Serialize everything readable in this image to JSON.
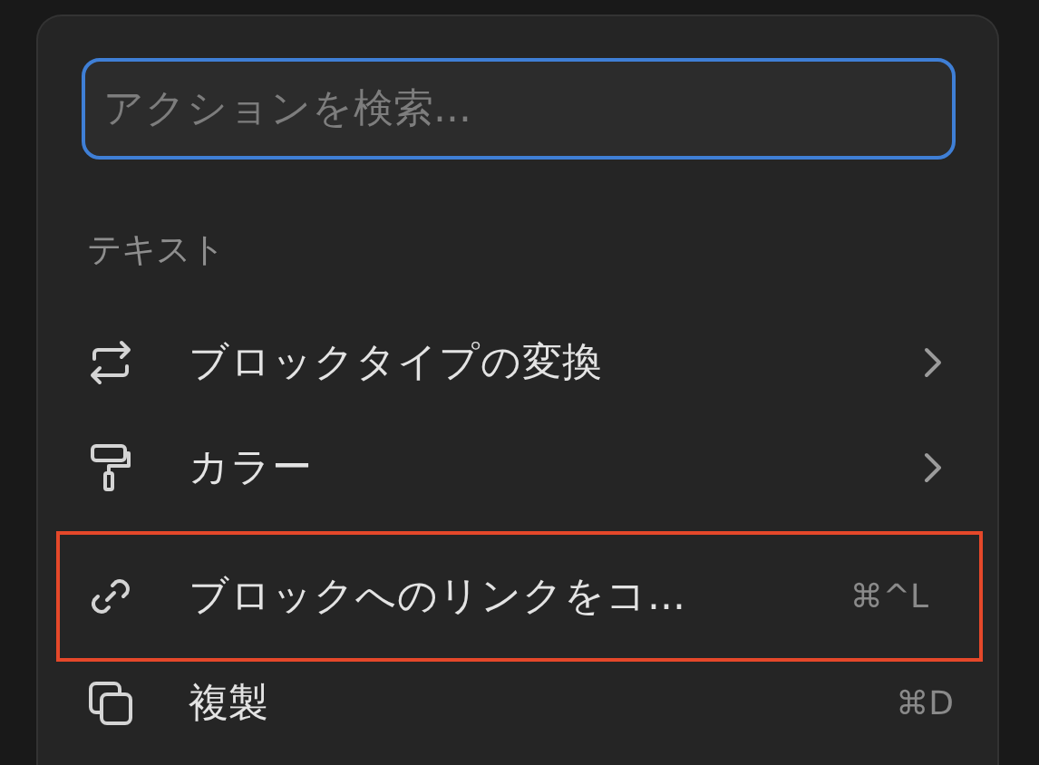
{
  "search": {
    "placeholder": "アクションを検索..."
  },
  "section": {
    "label": "テキスト"
  },
  "items": [
    {
      "label": "ブロックタイプの変換",
      "kind": "submenu",
      "highlighted": false
    },
    {
      "label": "カラー",
      "kind": "submenu",
      "highlighted": false
    },
    {
      "label": "ブロックへのリンクをコ...",
      "kind": "shortcut",
      "shortcut": "⌘^L",
      "highlighted": true
    },
    {
      "label": "複製",
      "kind": "shortcut",
      "shortcut": "⌘D",
      "highlighted": false
    }
  ]
}
